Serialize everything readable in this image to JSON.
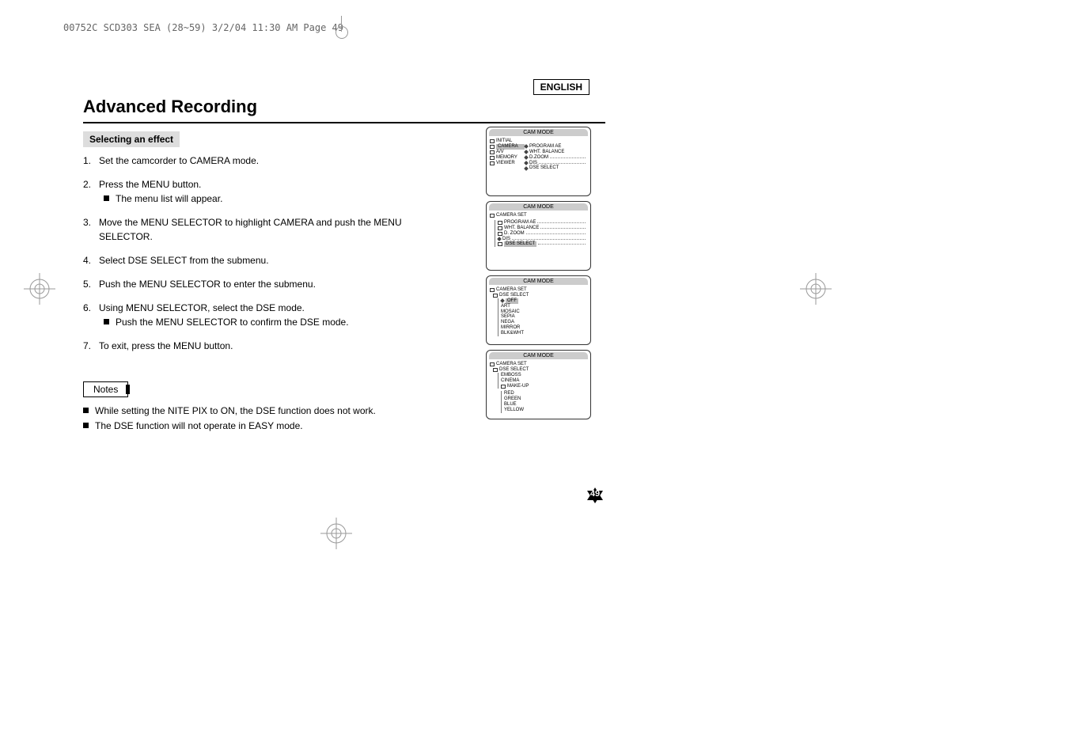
{
  "header_slug": "00752C SCD303 SEA (28~59)  3/2/04 11:30 AM  Page 49",
  "language": "ENGLISH",
  "title": "Advanced Recording",
  "subtitle": "Selecting an effect",
  "steps": [
    {
      "num": "1.",
      "text": "Set the camcorder to CAMERA mode."
    },
    {
      "num": "2.",
      "text": "Press the MENU button.",
      "sub": "The menu list will appear."
    },
    {
      "num": "3.",
      "text": "Move the MENU SELECTOR to highlight CAMERA and push the MENU SELECTOR."
    },
    {
      "num": "4.",
      "text": "Select DSE SELECT from the submenu."
    },
    {
      "num": "5.",
      "text": "Push the MENU SELECTOR to enter the submenu."
    },
    {
      "num": "6.",
      "text": "Using MENU SELECTOR, select the DSE mode.",
      "sub": "Push the MENU SELECTOR to confirm the DSE mode."
    },
    {
      "num": "7.",
      "text": "To exit, press the MENU button."
    }
  ],
  "notes_label": "Notes",
  "notes": [
    "While setting the NITE PIX to ON, the DSE function does not work.",
    "The DSE function will not operate in EASY mode."
  ],
  "screens": {
    "title": "CAM  MODE",
    "s1": {
      "left": [
        "INITIAL",
        "CAMERA",
        "A/V",
        "MEMORY",
        "VIEWER"
      ],
      "right": [
        "PROGRAM AE",
        "WHT. BALANCE",
        "D.ZOOM",
        "DIS",
        "DSE SELECT"
      ]
    },
    "s2": {
      "header": "CAMERA SET",
      "items": [
        "PROGRAM AE",
        "WHT. BALANCE",
        "D. ZOOM",
        "DIS",
        "DSE SELECT"
      ]
    },
    "s3": {
      "header1": "CAMERA SET",
      "header2": "DSE SELECT",
      "items": [
        "OFF",
        "ART",
        "MOSAIC",
        "SEPIA",
        "NEGA",
        "MIRROR",
        "BLK&WHT"
      ]
    },
    "s4": {
      "header1": "CAMERA SET",
      "header2": "DSE SELECT",
      "items1": [
        "EMBOSS",
        "CINEMA",
        "MAKE-UP"
      ],
      "items2": [
        "RED",
        "GREEN",
        "BLUE",
        "YELLOW"
      ]
    }
  },
  "page_number": "49"
}
